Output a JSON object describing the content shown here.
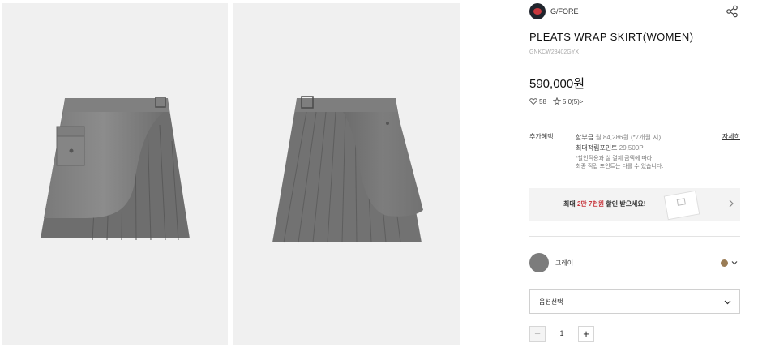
{
  "images": [
    {
      "alt": "front-view",
      "bg": "#f0f0f0"
    },
    {
      "alt": "back-view",
      "bg": "#f0f0f0"
    }
  ],
  "brand": {
    "name": "G/FORE"
  },
  "product": {
    "title": "PLEATS WRAP SKIRT(WOMEN)",
    "code": "GNKCW23402GYX",
    "price": "590,000원",
    "likes": "58",
    "rating": "5.0",
    "reviews_link": "(5)>"
  },
  "benefits": {
    "label": "추가혜택",
    "line1_prefix": "할부금",
    "line1_muted": " 월 84,286원 (*7개월 시)",
    "line2_prefix": "최대적립포인트",
    "line2_muted": " 29,500P",
    "note_line1": "*할인적용과 실 결제 금액에 따라",
    "note_line2": "최종 적립 포인트는 다를 수 있습니다.",
    "detail_link": "자세히"
  },
  "banner": {
    "prefix": "최대",
    "highlight": " 2만 7천원",
    "suffix": " 할인 받으세요!"
  },
  "color": {
    "name": "그레이",
    "swatch": "#7c7c7c",
    "picker_dot": "#9a7c55"
  },
  "option": {
    "label": "옵션선택"
  },
  "quantity": {
    "minus": "−",
    "value": "1",
    "plus": "+"
  },
  "accent": "#c8373d"
}
